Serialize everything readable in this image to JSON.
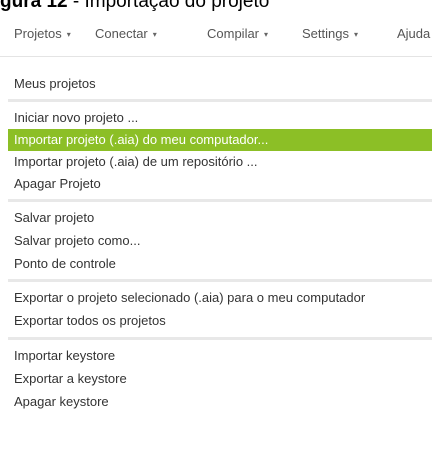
{
  "caption": {
    "bold_part": "gura 12",
    "rest": " - Importação do projeto"
  },
  "menubar": {
    "items": [
      {
        "label": "Projetos"
      },
      {
        "label": "Conectar"
      },
      {
        "label": "Compilar"
      },
      {
        "label": "Settings"
      },
      {
        "label": "Ajuda"
      }
    ],
    "caret_icon": "▾"
  },
  "projects_menu": {
    "highlight_color": "#8cbf26",
    "groups": [
      [
        "Meus projetos"
      ],
      [
        "Iniciar novo projeto ...",
        "Importar projeto (.aia) do meu computador...",
        "Importar projeto (.aia) de um repositório ...",
        "Apagar Projeto"
      ],
      [
        "Salvar projeto",
        "Salvar projeto como...",
        "Ponto de controle"
      ],
      [
        "Exportar o projeto selecionado (.aia) para o meu computador",
        "Exportar todos os projetos"
      ],
      [
        "Importar keystore",
        "Exportar a keystore",
        "Apagar keystore"
      ]
    ],
    "highlighted": "Importar projeto (.aia) do meu computador..."
  }
}
